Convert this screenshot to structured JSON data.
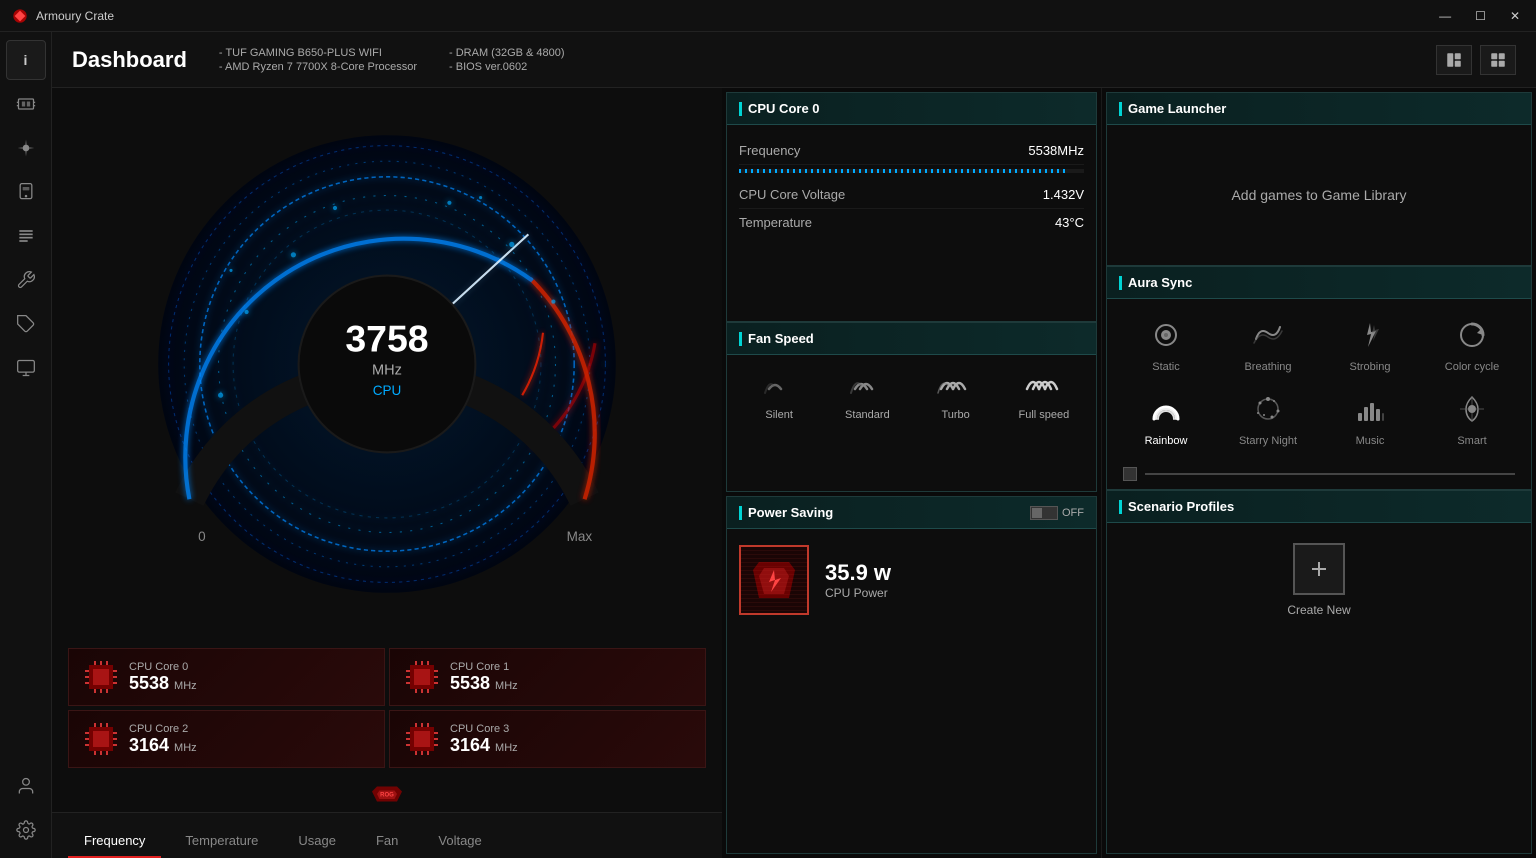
{
  "titleBar": {
    "appName": "Armoury Crate",
    "controls": {
      "minimize": "—",
      "maximize": "☐",
      "close": "✕"
    }
  },
  "header": {
    "title": "Dashboard",
    "specs": {
      "col1": [
        "- TUF GAMING B650-PLUS WIFI",
        "- AMD Ryzen 7 7700X 8-Core Processor"
      ],
      "col2": [
        "- DRAM (32GB & 4800)",
        "- BIOS ver.0602"
      ]
    }
  },
  "sidebar": {
    "items": [
      {
        "id": "info",
        "label": "i",
        "icon": "ℹ"
      },
      {
        "id": "hardware",
        "label": "hardware"
      },
      {
        "id": "aura",
        "label": "aura"
      },
      {
        "id": "device",
        "label": "device"
      },
      {
        "id": "tools",
        "label": "tools"
      },
      {
        "id": "wrench",
        "label": "wrench"
      },
      {
        "id": "tag",
        "label": "tag"
      },
      {
        "id": "display",
        "label": "display"
      },
      {
        "id": "user",
        "label": "user"
      },
      {
        "id": "settings",
        "label": "settings"
      }
    ]
  },
  "gauge": {
    "value": "3758",
    "unit": "MHz",
    "label": "CPU",
    "minLabel": "0",
    "maxLabel": "Max"
  },
  "cpuCards": [
    {
      "label": "CPU Core 0",
      "value": "5538",
      "unit": "MHz"
    },
    {
      "label": "CPU Core 1",
      "value": "5538",
      "unit": "MHz"
    },
    {
      "label": "CPU Core 2",
      "value": "3164",
      "unit": "MHz"
    },
    {
      "label": "CPU Core 3",
      "value": "3164",
      "unit": "MHz"
    }
  ],
  "bottomTabs": [
    {
      "id": "frequency",
      "label": "Frequency",
      "active": true
    },
    {
      "id": "temperature",
      "label": "Temperature",
      "active": false
    },
    {
      "id": "usage",
      "label": "Usage",
      "active": false
    },
    {
      "id": "fan",
      "label": "Fan",
      "active": false
    },
    {
      "id": "voltage",
      "label": "Voltage",
      "active": false
    }
  ],
  "cpuCore0": {
    "title": "CPU Core 0",
    "stats": [
      {
        "label": "Frequency",
        "value": "5538MHz"
      },
      {
        "label": "CPU Core Voltage",
        "value": "1.432V"
      },
      {
        "label": "Temperature",
        "value": "43°C"
      }
    ],
    "freqPercent": 95
  },
  "fanSpeed": {
    "title": "Fan Speed",
    "modes": [
      {
        "id": "silent",
        "label": "Silent",
        "level": 0
      },
      {
        "id": "standard",
        "label": "Standard",
        "level": 1
      },
      {
        "id": "turbo",
        "label": "Turbo",
        "level": 2
      },
      {
        "id": "fullspeed",
        "label": "Full speed",
        "level": 3
      }
    ]
  },
  "powerSaving": {
    "title": "Power Saving",
    "toggleLabel": "OFF",
    "value": "35.9 w",
    "label": "CPU Power"
  },
  "gameLauncher": {
    "title": "Game Launcher",
    "emptyText": "Add games to Game Library"
  },
  "auraSync": {
    "title": "Aura Sync",
    "modes": [
      {
        "id": "static",
        "label": "Static",
        "active": false
      },
      {
        "id": "breathing",
        "label": "Breathing",
        "active": false
      },
      {
        "id": "strobing",
        "label": "Strobing",
        "active": false
      },
      {
        "id": "colorcycle",
        "label": "Color cycle",
        "active": false
      },
      {
        "id": "rainbow",
        "label": "Rainbow",
        "active": true
      },
      {
        "id": "starrynight",
        "label": "Starry Night",
        "active": false
      },
      {
        "id": "music",
        "label": "Music",
        "active": false
      },
      {
        "id": "smart",
        "label": "Smart",
        "active": false
      }
    ]
  },
  "scenarioProfiles": {
    "title": "Scenario Profiles",
    "createLabel": "Create New"
  },
  "colors": {
    "accent": "#00d4d4",
    "danger": "#e02020",
    "cardBorder": "#1e3a3a",
    "headerBg": "#0a2020"
  }
}
